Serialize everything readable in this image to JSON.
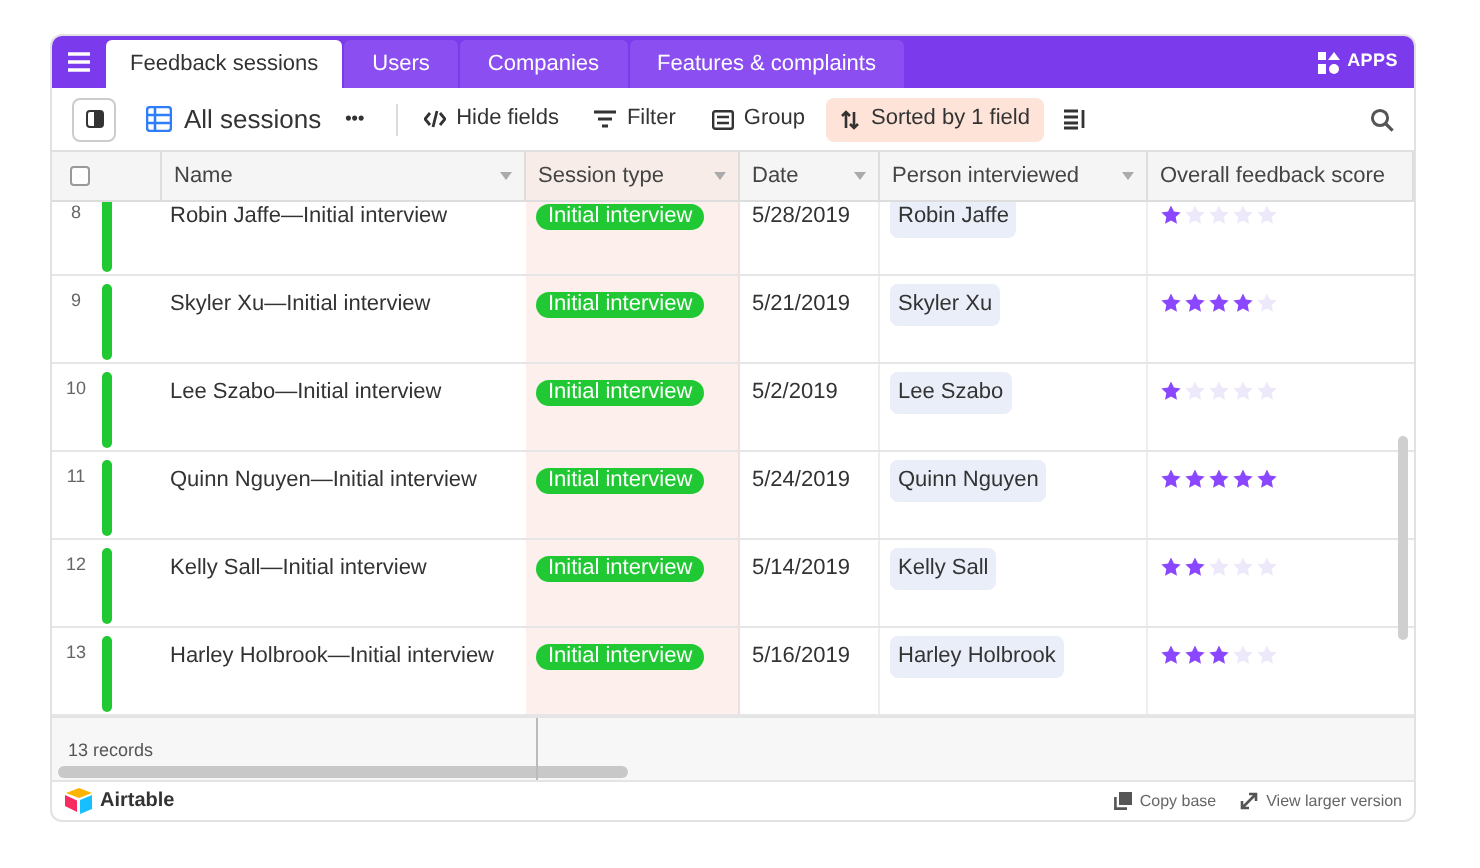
{
  "tabs": [
    {
      "label": "Feedback sessions",
      "selected": true
    },
    {
      "label": "Users",
      "selected": false
    },
    {
      "label": "Companies",
      "selected": false
    },
    {
      "label": "Features & complaints",
      "selected": false
    }
  ],
  "apps_label": "APPS",
  "toolbar": {
    "view_name": "All sessions",
    "more": "•••",
    "buttons": [
      {
        "label": "Hide fields",
        "active": false
      },
      {
        "label": "Filter",
        "active": false
      },
      {
        "label": "Group",
        "active": false
      },
      {
        "label": "Sorted by 1 field",
        "active": true
      }
    ]
  },
  "table": {
    "columns": [
      {
        "label": "Name",
        "sorted": false
      },
      {
        "label": "Session type",
        "sorted": true
      },
      {
        "label": "Date",
        "sorted": false
      },
      {
        "label": "Person interviewed",
        "sorted": false
      },
      {
        "label": "Overall feedback score",
        "sorted": false
      }
    ],
    "rows": [
      {
        "number": "8",
        "name": "Robin Jaffe—Initial interview",
        "session_type": "Initial interview",
        "date": "5/28/2019",
        "person": "Robin Jaffe",
        "stars": 1
      },
      {
        "number": "9",
        "name": "Skyler Xu—Initial interview",
        "session_type": "Initial interview",
        "date": "5/21/2019",
        "person": "Skyler Xu",
        "stars": 4
      },
      {
        "number": "10",
        "name": "Lee Szabo—Initial interview",
        "session_type": "Initial interview",
        "date": "5/2/2019",
        "person": "Lee Szabo",
        "stars": 1
      },
      {
        "number": "11",
        "name": "Quinn Nguyen—Initial interview",
        "session_type": "Initial interview",
        "date": "5/24/2019",
        "person": "Quinn Nguyen",
        "stars": 5
      },
      {
        "number": "12",
        "name": "Kelly Sall—Initial interview",
        "session_type": "Initial interview",
        "date": "5/14/2019",
        "person": "Kelly Sall",
        "stars": 2
      },
      {
        "number": "13",
        "name": "Harley Holbrook—Initial interview",
        "session_type": "Initial interview",
        "date": "5/16/2019",
        "person": "Harley Holbrook",
        "stars": 3
      }
    ],
    "record_count": "13 records",
    "select_all_checked": false
  },
  "footer": {
    "brand": "Airtable",
    "links": [
      "Copy base",
      "View larger version"
    ]
  }
}
